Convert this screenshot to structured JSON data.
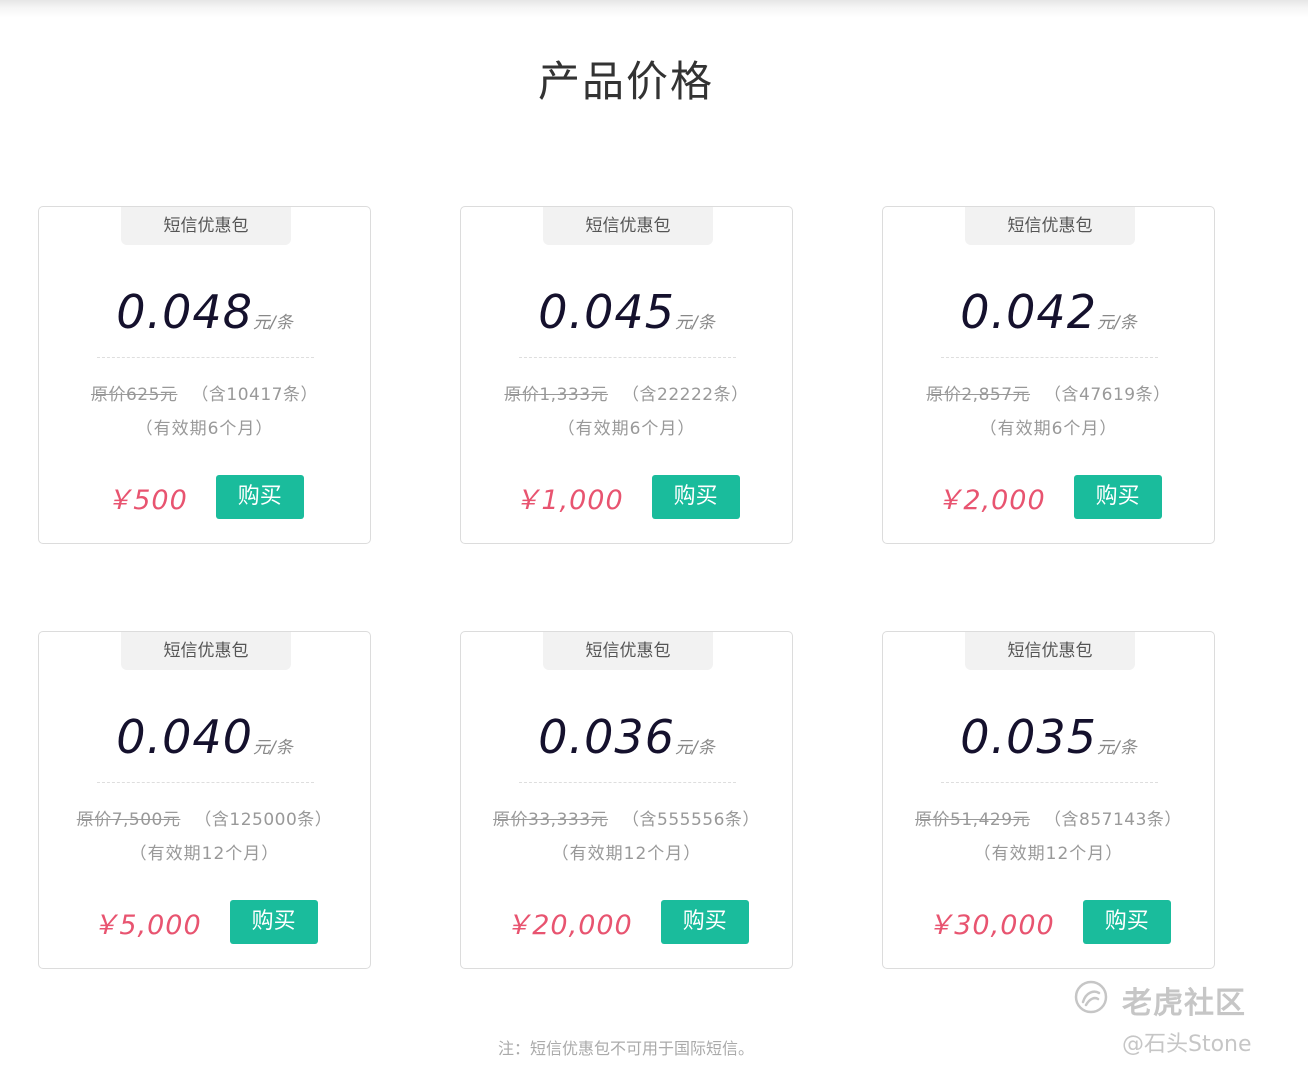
{
  "page": {
    "title": "产品价格",
    "note": "注：短信优惠包不可用于国际短信。"
  },
  "packages": [
    {
      "tag": "短信优惠包",
      "unit_price": "0.048",
      "unit": "元/条",
      "original_price": "原价625元",
      "count": "（含10417条）",
      "validity": "（有效期6个月）",
      "total": "￥500",
      "buy_label": "购买"
    },
    {
      "tag": "短信优惠包",
      "unit_price": "0.045",
      "unit": "元/条",
      "original_price": "原价1,333元",
      "count": "（含22222条）",
      "validity": "（有效期6个月）",
      "total": "￥1,000",
      "buy_label": "购买"
    },
    {
      "tag": "短信优惠包",
      "unit_price": "0.042",
      "unit": "元/条",
      "original_price": "原价2,857元",
      "count": "（含47619条）",
      "validity": "（有效期6个月）",
      "total": "￥2,000",
      "buy_label": "购买"
    },
    {
      "tag": "短信优惠包",
      "unit_price": "0.040",
      "unit": "元/条",
      "original_price": "原价7,500元",
      "count": "（含125000条）",
      "validity": "（有效期12个月）",
      "total": "￥5,000",
      "buy_label": "购买"
    },
    {
      "tag": "短信优惠包",
      "unit_price": "0.036",
      "unit": "元/条",
      "original_price": "原价33,333元",
      "count": "（含555556条）",
      "validity": "（有效期12个月）",
      "total": "￥20,000",
      "buy_label": "购买"
    },
    {
      "tag": "短信优惠包",
      "unit_price": "0.035",
      "unit": "元/条",
      "original_price": "原价51,429元",
      "count": "（含857143条）",
      "validity": "（有效期12个月）",
      "total": "￥30,000",
      "buy_label": "购买"
    }
  ],
  "watermark": {
    "brand": "老虎社区",
    "author": "@石头Stone",
    "logo_icon": "tiger-community-logo-icon"
  },
  "colors": {
    "accent": "#1abc9c",
    "price_red": "#e85470",
    "unit_price": "#15112d"
  }
}
